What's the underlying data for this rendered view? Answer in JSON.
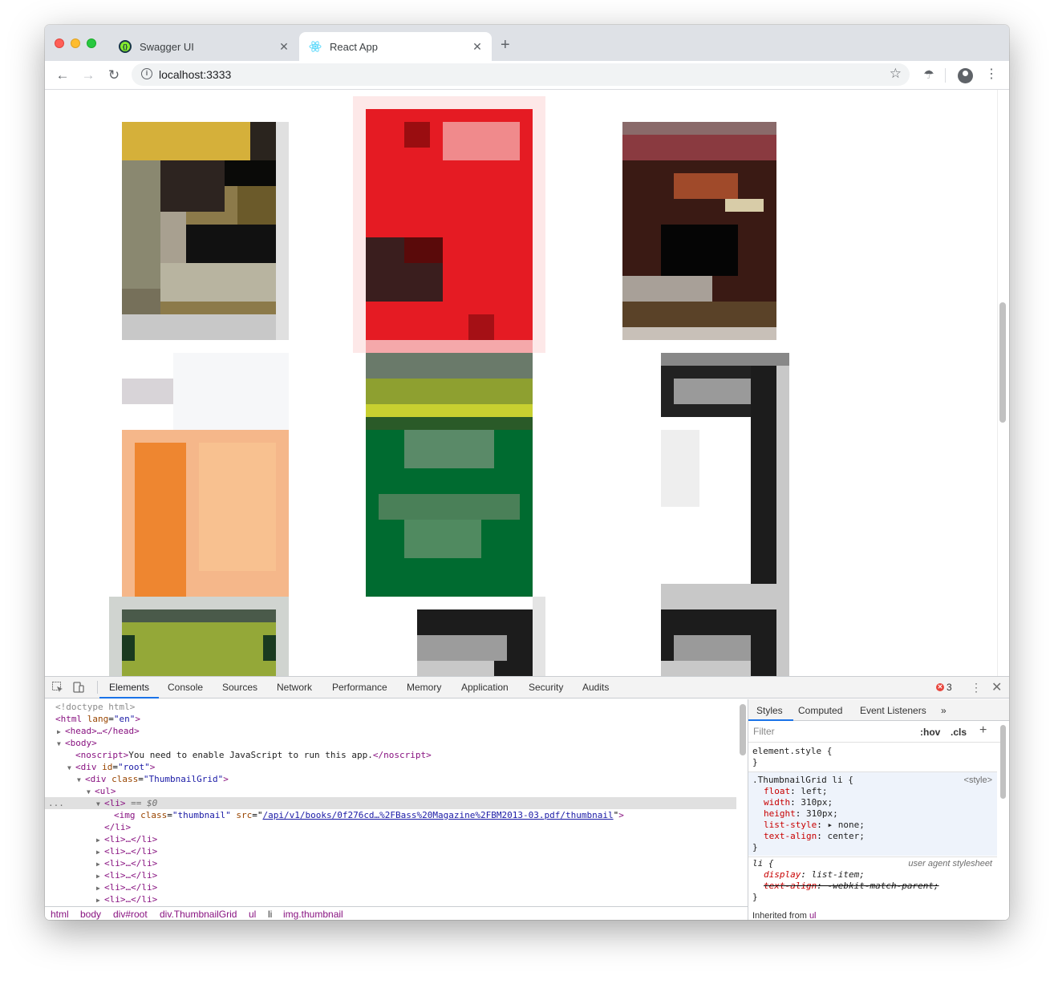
{
  "browser": {
    "tabs": [
      {
        "title": "Swagger UI",
        "icon": "swagger-icon",
        "active": false
      },
      {
        "title": "React App",
        "icon": "react-icon",
        "active": true
      }
    ],
    "url": "localhost:3333"
  },
  "devtools": {
    "tabs": [
      "Elements",
      "Console",
      "Sources",
      "Network",
      "Performance",
      "Memory",
      "Application",
      "Security",
      "Audits"
    ],
    "active_tab": "Elements",
    "error_count": "3",
    "dom": {
      "doctype": "<!doctype html>",
      "html_open": "<html",
      "html_attr": "lang",
      "html_val": "\"en\"",
      "head": "<head>…</head>",
      "body": "<body>",
      "noscript_open": "<noscript>",
      "noscript_text": "You need to enable JavaScript to run this app.",
      "noscript_close": "</noscript>",
      "div_root_open": "<div",
      "div_root_attr": "id",
      "div_root_val": "\"root\"",
      "div_grid_open": "<div",
      "div_grid_attr": "class",
      "div_grid_val": "\"ThumbnailGrid\"",
      "ul": "<ul>",
      "li_selected": "<li>",
      "li_selected_marker": " == $0",
      "img_open": "<img",
      "img_class_attr": "class",
      "img_class_val": "\"thumbnail\"",
      "img_src_attr": "src",
      "img_src_val": "/api/v1/books/0f276cd…%2FBass%20Magazine%2FBM2013-03.pdf/thumbnail",
      "li_close": "</li>",
      "li_collapsed": "<li>…</li>",
      "ellipsis": "..."
    },
    "breadcrumbs": [
      "html",
      "body",
      "div#root",
      "div.ThumbnailGrid",
      "ul",
      "li",
      "img.thumbnail"
    ],
    "styles": {
      "tabs": [
        "Styles",
        "Computed",
        "Event Listeners"
      ],
      "more": "»",
      "filter_placeholder": "Filter",
      "hov": ":hov",
      "cls": ".cls",
      "element_style": "element.style {",
      "close_brace": "}",
      "grid_selector": ".ThumbnailGrid li {",
      "grid_source": "<style>",
      "grid_props": [
        {
          "prop": "float",
          "value": "left;"
        },
        {
          "prop": "width",
          "value": "310px;"
        },
        {
          "prop": "height",
          "value": "310px;"
        },
        {
          "prop": "list-style",
          "value": "▸ none;"
        },
        {
          "prop": "text-align",
          "value": "center;"
        }
      ],
      "li_selector": "li {",
      "li_source": "user agent stylesheet",
      "li_props": [
        {
          "prop": "display",
          "value": "list-item;"
        },
        {
          "prop": "text-align",
          "value": "-webkit-match-parent;"
        }
      ],
      "inherited_label": "Inherited from",
      "inherited_tag": "ul"
    }
  }
}
